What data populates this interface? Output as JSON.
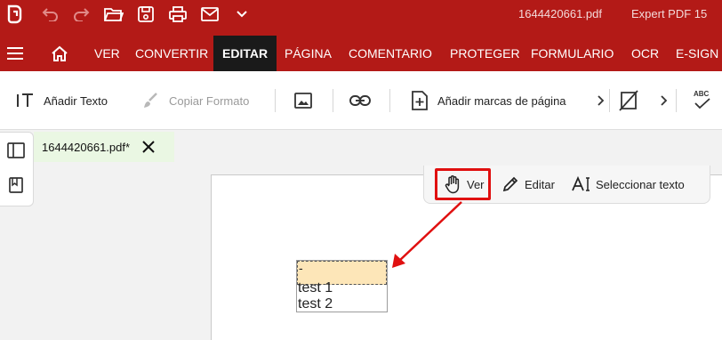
{
  "titlebar": {
    "document_title": "1644420661.pdf",
    "app_title": "Expert PDF 15",
    "icons": [
      "app-logo-icon",
      "undo-icon",
      "redo-icon",
      "open-folder-icon",
      "save-icon",
      "print-icon",
      "mail-icon",
      "chevron-down-icon"
    ]
  },
  "ribbon": {
    "tabs": [
      {
        "label": "VER",
        "active": false
      },
      {
        "label": "CONVERTIR",
        "active": false
      },
      {
        "label": "EDITAR",
        "active": true
      },
      {
        "label": "PÁGINA",
        "active": false
      },
      {
        "label": "COMENTARIO",
        "active": false
      },
      {
        "label": "PROTEGER",
        "active": false
      },
      {
        "label": "FORMULARIO",
        "active": false
      },
      {
        "label": "OCR",
        "active": false
      },
      {
        "label": "E-SIGN",
        "active": false
      }
    ]
  },
  "toolbar": {
    "add_text_label": "Añadir Texto",
    "copy_format_label": "Copiar Formato",
    "add_bookmarks_label": "Añadir marcas de página",
    "spell_check_text": "ABC"
  },
  "document_tab": {
    "label": "1644420661.pdf*"
  },
  "mode_toolbar": {
    "view_label": "Ver",
    "edit_label": "Editar",
    "select_text_label": "Seleccionar texto"
  },
  "listbox": {
    "selected_value": "-",
    "items": [
      "test 1",
      "test 2"
    ]
  },
  "colors": {
    "brand_red": "#b31a17",
    "active_tab": "#1a1a1a",
    "annotation_red": "#e01010",
    "selected_item": "#fde6b8",
    "doc_tab_green": "#eaf7e3"
  }
}
